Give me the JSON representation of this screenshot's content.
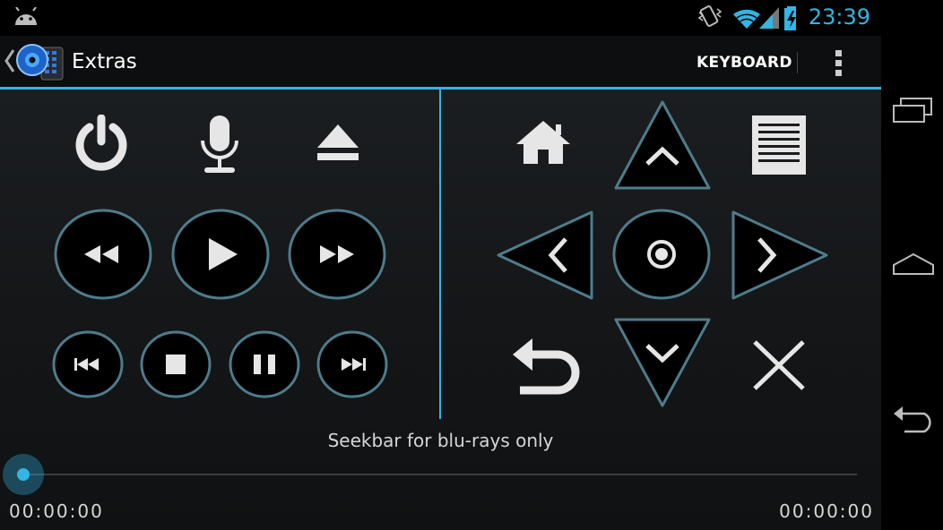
{
  "status_bar": {
    "time": "23:39",
    "icons": [
      "android-debug-icon",
      "vibrate-icon",
      "wifi-icon",
      "signal-icon",
      "battery-charging-icon"
    ]
  },
  "action_bar": {
    "title": "Extras",
    "keyboard_label": "KEYBOARD",
    "icons": [
      "up-caret-icon",
      "app-disc-icon",
      "overflow-menu-icon"
    ]
  },
  "media_controls": [
    "power",
    "microphone",
    "eject",
    "rewind",
    "play",
    "fast-forward",
    "previous",
    "stop",
    "pause",
    "next"
  ],
  "navigation_controls": [
    "home",
    "up",
    "menu",
    "left",
    "select",
    "right",
    "back",
    "down",
    "close"
  ],
  "seekbar": {
    "label": "Seekbar for blu-rays only",
    "position": 0,
    "time_start": "00:00:00",
    "time_end": "00:00:00"
  },
  "nav_bar": [
    "recent-apps",
    "home",
    "back"
  ],
  "colors": {
    "accent": "#33b5e5",
    "background": "#1a1c1e",
    "button_fill": "#000000",
    "icon": "#e6e6e6"
  }
}
